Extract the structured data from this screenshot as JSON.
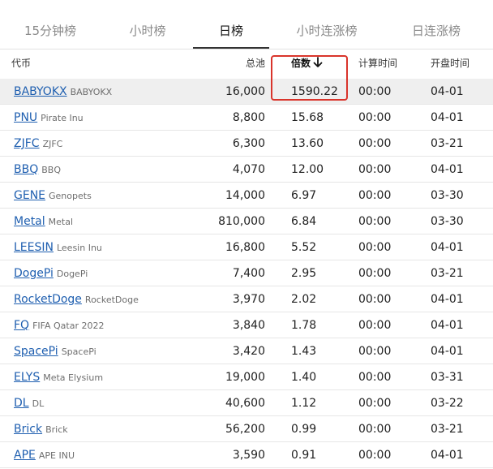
{
  "tabs": [
    {
      "label": "15分钟榜",
      "active": false
    },
    {
      "label": "小时榜",
      "active": false
    },
    {
      "label": "日榜",
      "active": true
    },
    {
      "label": "小时连涨榜",
      "active": false
    },
    {
      "label": "日连涨榜",
      "active": false
    }
  ],
  "columns": {
    "coin": "代币",
    "pool": "总池",
    "multiple": "倍数",
    "calc_time": "计算时间",
    "open_time": "开盘时间"
  },
  "sort": {
    "column": "multiple",
    "direction": "descending",
    "icon": "arrow-down-icon"
  },
  "colors": {
    "link": "#1f5fb0",
    "highlight_row": "#efefef",
    "annotation": "#d9342b",
    "active_tab": "#111111",
    "inactive_tab": "#8a8a8a"
  },
  "rows": [
    {
      "symbol": "BABYOKX",
      "name": "BABYOKX",
      "pool": "16,000",
      "multiple": "1590.22",
      "calc": "00:00",
      "open": "04-01"
    },
    {
      "symbol": "PNU",
      "name": "Pirate Inu",
      "pool": "8,800",
      "multiple": "15.68",
      "calc": "00:00",
      "open": "04-01"
    },
    {
      "symbol": "ZJFC",
      "name": "ZJFC",
      "pool": "6,300",
      "multiple": "13.60",
      "calc": "00:00",
      "open": "03-21"
    },
    {
      "symbol": "BBQ",
      "name": "BBQ",
      "pool": "4,070",
      "multiple": "12.00",
      "calc": "00:00",
      "open": "04-01"
    },
    {
      "symbol": "GENE",
      "name": "Genopets",
      "pool": "14,000",
      "multiple": "6.97",
      "calc": "00:00",
      "open": "03-30"
    },
    {
      "symbol": "Metal",
      "name": "Metal",
      "pool": "810,000",
      "multiple": "6.84",
      "calc": "00:00",
      "open": "03-30"
    },
    {
      "symbol": "LEESIN",
      "name": "Leesin Inu",
      "pool": "16,800",
      "multiple": "5.52",
      "calc": "00:00",
      "open": "04-01"
    },
    {
      "symbol": "DogePi",
      "name": "DogePi",
      "pool": "7,400",
      "multiple": "2.95",
      "calc": "00:00",
      "open": "03-21"
    },
    {
      "symbol": "RocketDoge",
      "name": "RocketDoge",
      "pool": "3,970",
      "multiple": "2.02",
      "calc": "00:00",
      "open": "04-01"
    },
    {
      "symbol": "FQ",
      "name": "FIFA Qatar 2022",
      "pool": "3,840",
      "multiple": "1.78",
      "calc": "00:00",
      "open": "04-01"
    },
    {
      "symbol": "SpacePi",
      "name": "SpacePi",
      "pool": "3,420",
      "multiple": "1.43",
      "calc": "00:00",
      "open": "04-01"
    },
    {
      "symbol": "ELYS",
      "name": "Meta Elysium",
      "pool": "19,000",
      "multiple": "1.40",
      "calc": "00:00",
      "open": "03-31"
    },
    {
      "symbol": "DL",
      "name": "DL",
      "pool": "40,600",
      "multiple": "1.12",
      "calc": "00:00",
      "open": "03-22"
    },
    {
      "symbol": "Brick",
      "name": "Brick",
      "pool": "56,200",
      "multiple": "0.99",
      "calc": "00:00",
      "open": "03-21"
    },
    {
      "symbol": "APE",
      "name": "APE INU",
      "pool": "3,590",
      "multiple": "0.91",
      "calc": "00:00",
      "open": "04-01"
    }
  ]
}
